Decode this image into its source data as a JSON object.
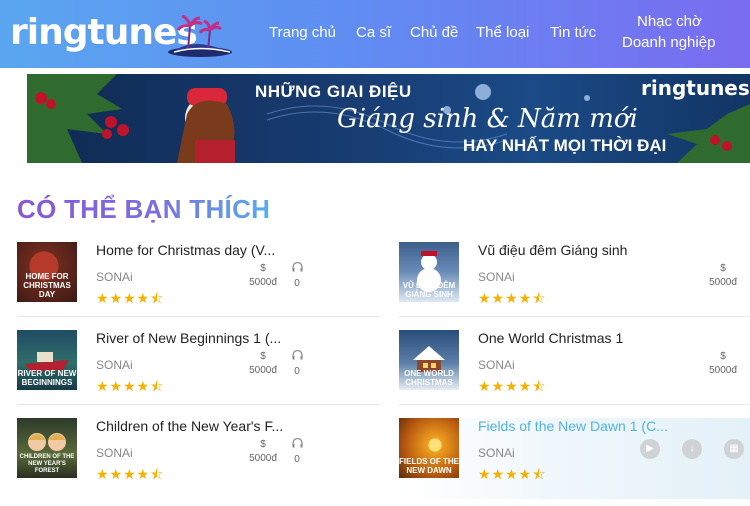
{
  "colors": {
    "header_start": "#5aa6f0",
    "header_end": "#7a6cf0",
    "star": "#f5b000",
    "active_title": "#4fb3e3"
  },
  "header": {
    "logo": "ringtunes",
    "nav": {
      "home": "Trang chủ",
      "artists": "Ca sĩ",
      "topics": "Chủ đề",
      "genres": "Thể loại",
      "news": "Tin tức",
      "business_line1": "Nhạc chờ",
      "business_line2": "Doanh nghiệp"
    }
  },
  "banner": {
    "line1": "NHỮNG GIAI ĐIỆU",
    "line2": "Giáng sinh & Năm mới",
    "line3": "HAY NHẤT MỌI THỜI ĐẠI",
    "logo": "ringtunes"
  },
  "section_title": "CÓ THỂ BẠN THÍCH",
  "songs": [
    {
      "title": "Home for Christmas day (V...",
      "artist": "SONAi",
      "rating": 4.5,
      "price_symbol": "$",
      "price": "5000đ",
      "listens": "0",
      "thumb_caption": "HOME FOR CHRISTMAS DAY",
      "thumb_icon": "ornament-thumbnail"
    },
    {
      "title": "Vũ điệu đêm Giáng sinh",
      "artist": "SONAi",
      "rating": 4.5,
      "price_symbol": "$",
      "price": "5000đ",
      "thumb_caption": "VŨ ĐIỆU ĐÊM GIÁNG SINH",
      "thumb_icon": "snowman-thumbnail"
    },
    {
      "title": "River of New Beginnings 1 (...",
      "artist": "SONAi",
      "rating": 4.5,
      "price_symbol": "$",
      "price": "5000đ",
      "listens": "0",
      "thumb_caption": "RIVER OF NEW BEGINNINGS",
      "thumb_icon": "boat-thumbnail"
    },
    {
      "title": "One World Christmas 1",
      "artist": "SONAi",
      "rating": 4.5,
      "price_symbol": "$",
      "price": "5000đ",
      "thumb_caption": "ONE WORLD CHRISTMAS",
      "thumb_icon": "house-thumbnail"
    },
    {
      "title": "Children of the New Year's F...",
      "artist": "SONAi",
      "rating": 4.5,
      "price_symbol": "$",
      "price": "5000đ",
      "listens": "0",
      "thumb_caption": "CHILDREN OF THE NEW YEAR'S FOREST",
      "thumb_icon": "children-thumbnail"
    },
    {
      "title": "Fields of the New Dawn 1 (C...",
      "artist": "SONAi",
      "rating": 4.5,
      "thumb_caption": "FIELDS OF THE NEW DAWN",
      "thumb_icon": "fields-thumbnail",
      "actions": [
        "play-icon",
        "download-icon",
        "gift-icon"
      ]
    }
  ]
}
